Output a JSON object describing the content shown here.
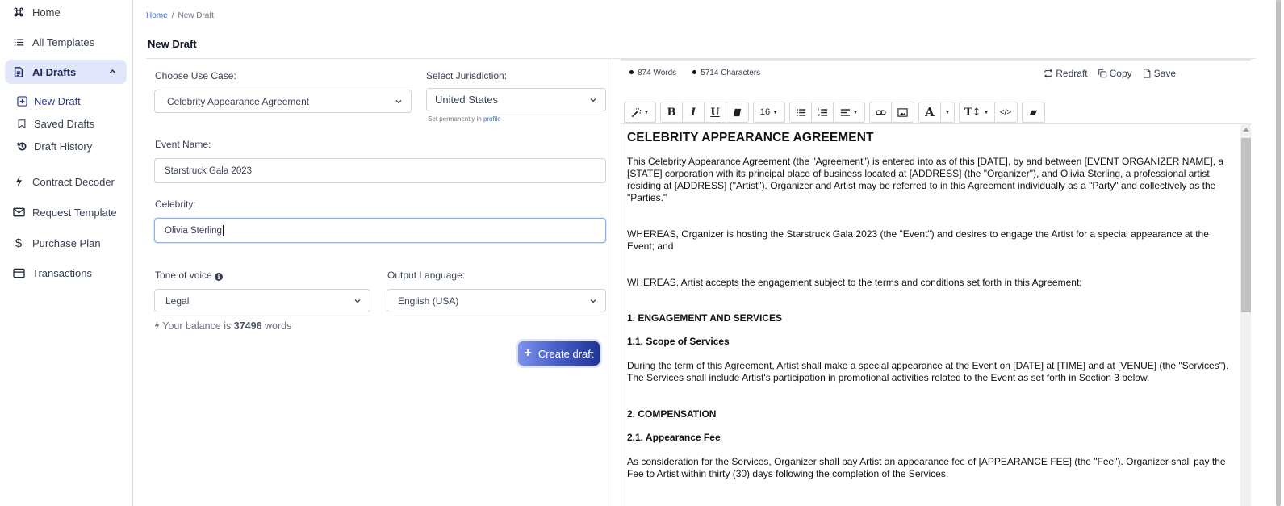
{
  "sidebar": {
    "items": [
      {
        "label": "Home",
        "icon": "command-icon"
      },
      {
        "label": "All Templates",
        "icon": "list-icon"
      },
      {
        "label": "AI Drafts",
        "icon": "document-icon",
        "active": true,
        "expanded": true
      },
      {
        "label": "Contract Decoder",
        "icon": "bolt-icon"
      },
      {
        "label": "Request Template",
        "icon": "envelope-icon"
      },
      {
        "label": "Purchase Plan",
        "icon": "dollar-icon"
      },
      {
        "label": "Transactions",
        "icon": "card-icon"
      }
    ],
    "sub_items": [
      {
        "label": "New Draft",
        "icon": "plus-square-icon",
        "active": true
      },
      {
        "label": "Saved Drafts",
        "icon": "bookmark-icon"
      },
      {
        "label": "Draft History",
        "icon": "history-icon"
      }
    ]
  },
  "breadcrumb": {
    "home": "Home",
    "separator": "/",
    "current": "New Draft"
  },
  "page_title": "New Draft",
  "form": {
    "use_case": {
      "label": "Choose Use Case:",
      "value": "Celebrity Appearance Agreement"
    },
    "jurisdiction": {
      "label": "Select Jurisdiction:",
      "value": "United States",
      "hint_prefix": "Set permanently in",
      "hint_link": "profile"
    },
    "event_name": {
      "label": "Event Name:",
      "value": "Starstruck Gala 2023"
    },
    "celebrity": {
      "label": "Celebrity:",
      "value": "Olivia Sterling"
    },
    "tone": {
      "label": "Tone of voice",
      "value": "Legal"
    },
    "language": {
      "label": "Output Language:",
      "value": "English (USA)"
    },
    "balance": {
      "prefix": "Your balance is",
      "amount": "37496",
      "suffix": "words"
    },
    "create_button": "Create draft"
  },
  "editor": {
    "stats": {
      "words": "874 Words",
      "characters": "5714 Characters"
    },
    "actions": {
      "redraft": "Redraft",
      "copy": "Copy",
      "save": "Save"
    },
    "toolbar": {
      "font_size": "16"
    },
    "document": {
      "title": "CELEBRITY APPEARANCE AGREEMENT",
      "intro": "This Celebrity Appearance Agreement (the \"Agreement\") is entered into as of this [DATE], by and between [EVENT ORGANIZER NAME], a [STATE] corporation with its principal place of business located at [ADDRESS] (the \"Organizer\"), and Olivia Sterling, a professional artist residing at [ADDRESS] (\"Artist\"). Organizer and Artist may be referred to in this Agreement individually as a \"Party\" and collectively as the \"Parties.\"",
      "whereas_1": "WHEREAS, Organizer is hosting the Starstruck Gala 2023 (the \"Event\") and desires to engage the Artist for a special appearance at the Event; and",
      "whereas_2": "WHEREAS, Artist accepts the engagement subject to the terms and conditions set forth in this Agreement;",
      "section_1": "1. ENGAGEMENT AND SERVICES",
      "section_1_1": "1.1. Scope of Services",
      "section_1_1_text": "During the term of this Agreement, Artist shall make a special appearance at the Event on [DATE] at [TIME] and at [VENUE] (the \"Services\"). The Services shall include Artist's participation in promotional activities related to the Event as set forth in Section 3 below.",
      "section_2": "2. COMPENSATION",
      "section_2_1": "2.1. Appearance Fee",
      "section_2_1_text": "As consideration for the Services, Organizer shall pay Artist an appearance fee of [APPEARANCE FEE] (the \"Fee\"). Organizer shall pay the Fee to Artist within thirty (30) days following the completion of the Services."
    }
  }
}
